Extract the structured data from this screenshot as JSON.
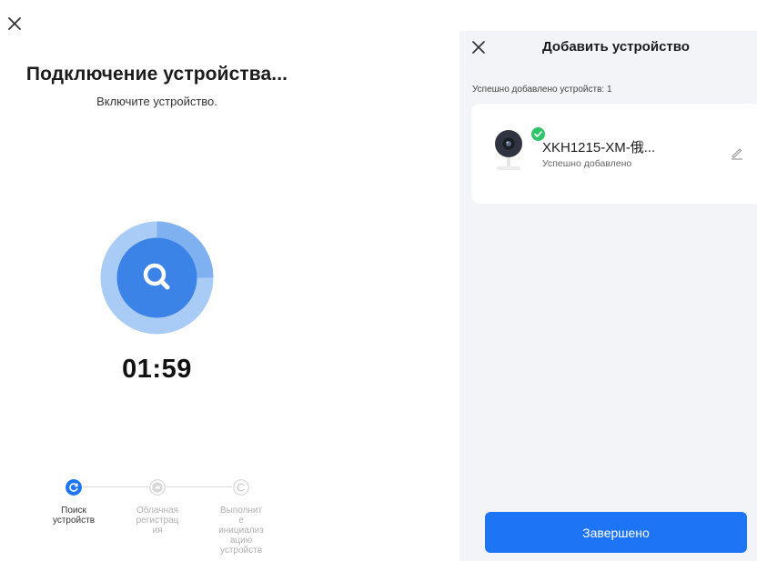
{
  "left_screen": {
    "title": "Подключение устройства...",
    "subtitle": "Включите устройство.",
    "icons": {
      "close": "close-icon",
      "search": "search-icon"
    },
    "timer": "01:59",
    "progress": {
      "ring_fraction": 0.25
    },
    "steps": [
      {
        "label": "Поиск\nустройств",
        "state": "active",
        "icon": "refresh-icon"
      },
      {
        "label": "Облачная\nрегистрац\nия",
        "state": "pending",
        "icon": "cloud-icon"
      },
      {
        "label": "Выполнит\nе\nинициализ\nацию\nустройств",
        "state": "pending",
        "icon": "init-icon"
      }
    ]
  },
  "right_screen": {
    "title": "Добавить устройство",
    "added_count": "Успешно добавлено устройств: 1",
    "device": {
      "name": "XKH1215-XM-俄...",
      "status": "Успешно добавлено",
      "icon": "camera-icon",
      "badge_icon": "check-icon"
    },
    "done_label": "Завершено"
  },
  "colors": {
    "accent": "#1d74f5",
    "radar_inner": "#3b83e6",
    "radar_outer": "#a9ccf7",
    "success": "#2fc46a",
    "right_bg": "#f3f4f7"
  }
}
